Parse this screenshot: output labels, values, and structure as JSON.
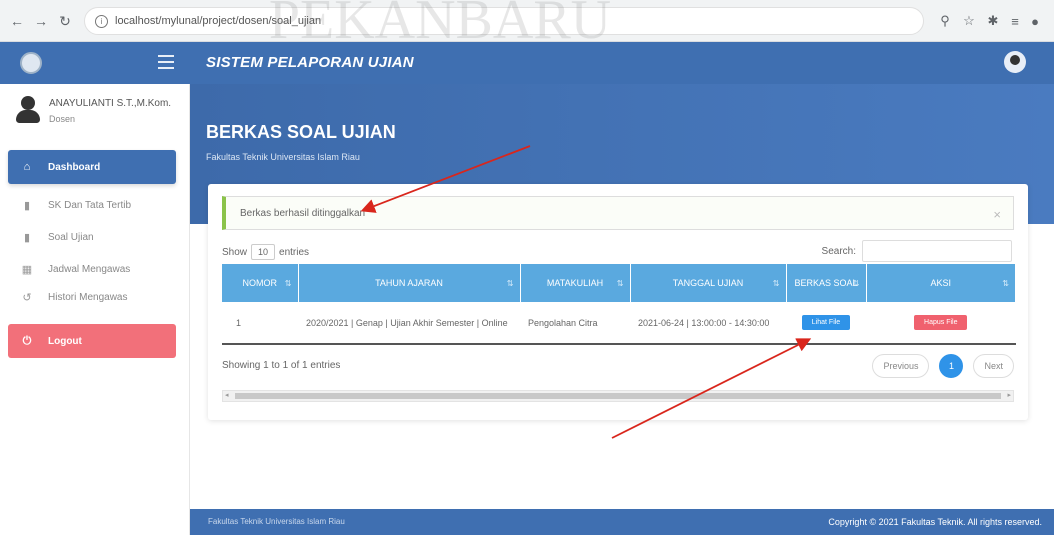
{
  "browser": {
    "url": "localhost/mylunal/project/dosen/soal_ujian"
  },
  "watermark": {
    "text": "PEKANBARU"
  },
  "sidebar": {
    "user_name": "ANAYULIANTI S.T.,M.Kom.",
    "user_role": "Dosen",
    "items": [
      {
        "label": "Dashboard",
        "icon": "home-icon"
      },
      {
        "label": "SK Dan Tata Tertib",
        "icon": "file-icon"
      },
      {
        "label": "Soal Ujian",
        "icon": "file-icon"
      },
      {
        "label": "Jadwal Mengawas",
        "icon": "calendar-icon"
      },
      {
        "label": "Histori Mengawas",
        "icon": "history-icon"
      },
      {
        "label": "Logout",
        "icon": "power-icon"
      }
    ]
  },
  "header": {
    "app_title": "SISTEM PELAPORAN UJIAN",
    "page_title": "BERKAS SOAL UJIAN",
    "page_subtitle": "Fakultas Teknik Universitas Islam Riau"
  },
  "alert": {
    "text": "Berkas berhasil ditinggalkan",
    "close": "×"
  },
  "datatable": {
    "show_label": "Show",
    "length_value": "10",
    "entries_label": "entries",
    "search_label": "Search:",
    "columns": [
      "NOMOR",
      "TAHUN AJARAN",
      "MATAKULIAH",
      "TANGGAL UJIAN",
      "BERKAS SOAL",
      "AKSI"
    ],
    "rows": [
      {
        "nomor": "1",
        "tahun_ajaran": "2020/2021 | Genap | Ujian Akhir Semester | Online",
        "matakuliah": "Pengolahan Citra",
        "tanggal_ujian": "2021-06-24 | 13:00:00 - 14:30:00",
        "berkas_button": "Lihat File",
        "aksi_button": "Hapus File"
      }
    ],
    "info": "Showing 1 to 1 of 1 entries",
    "pagination": {
      "previous": "Previous",
      "current": "1",
      "next": "Next"
    }
  },
  "footer": {
    "left": "Fakultas Teknik Universitas Islam Riau",
    "right": "Copyright © 2021 Fakultas Teknik. All rights reserved."
  },
  "colors": {
    "primary": "#3f6fb1",
    "table_header": "#5aa9df",
    "logout": "#f2707a",
    "button_blue": "#2f93e8",
    "button_red": "#f0616e"
  }
}
